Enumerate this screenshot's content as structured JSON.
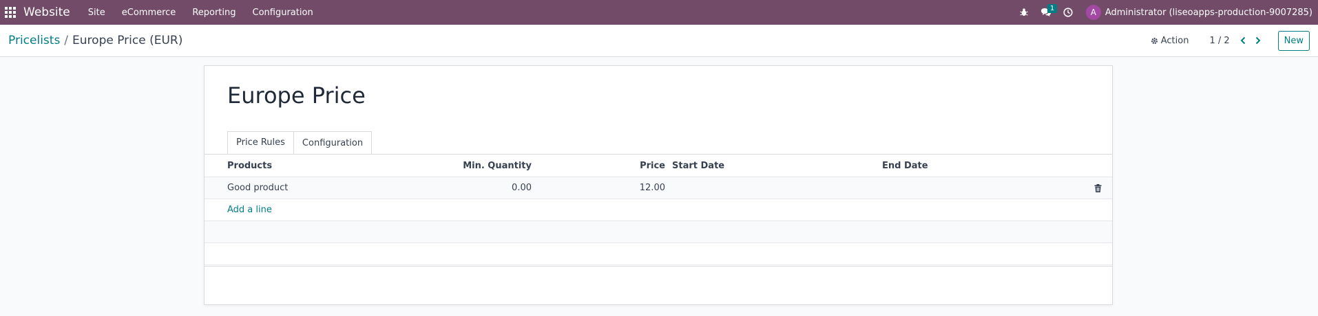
{
  "navbar": {
    "brand": "Website",
    "menu": [
      "Site",
      "eCommerce",
      "Reporting",
      "Configuration"
    ],
    "chat_badge": "1",
    "avatar_initial": "A",
    "user": "Administrator (liseoapps-production-9007285)"
  },
  "control": {
    "breadcrumb_parent": "Pricelists",
    "breadcrumb_sep": "/",
    "breadcrumb_current": "Europe Price (EUR)",
    "action_label": "Action",
    "pager": "1 / 2",
    "new_label": "New"
  },
  "form": {
    "title": "Europe Price",
    "tabs": [
      "Price Rules",
      "Configuration"
    ],
    "columns": {
      "products": "Products",
      "min_qty": "Min. Quantity",
      "price": "Price",
      "start_date": "Start Date",
      "end_date": "End Date"
    },
    "rows": [
      {
        "product": "Good product",
        "min_qty": "0.00",
        "price": "12.00",
        "start_date": "",
        "end_date": ""
      }
    ],
    "add_line": "Add a line"
  },
  "colors": {
    "navbar": "#714b67",
    "accent": "#017e84",
    "avatar": "#a349a4"
  },
  "icons": [
    "apps-grid-icon",
    "bug-icon",
    "chat-icon",
    "clock-icon",
    "gear-icon",
    "chevron-left-icon",
    "chevron-right-icon",
    "trash-icon"
  ]
}
